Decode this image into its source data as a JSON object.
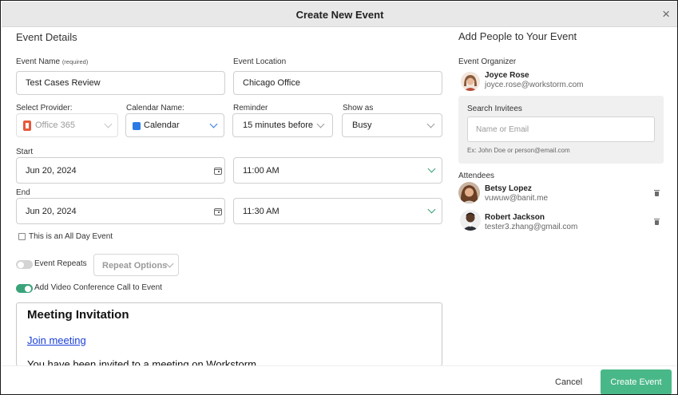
{
  "dialog": {
    "title": "Create New Event",
    "close_glyph": "×"
  },
  "event_details": {
    "section_title": "Event Details",
    "event_name": {
      "label": "Event Name",
      "label_note": "(required)",
      "value": "Test Cases Review"
    },
    "event_location": {
      "label": "Event Location",
      "value": "Chicago Office"
    },
    "provider": {
      "label": "Select Provider:",
      "value": "Office 365",
      "icon": "office-icon"
    },
    "calendar": {
      "label": "Calendar Name:",
      "value": "Calendar",
      "color": "#2c7be5"
    },
    "reminder": {
      "label": "Reminder",
      "value": "15 minutes before"
    },
    "show_as": {
      "label": "Show as",
      "value": "Busy"
    },
    "start": {
      "label": "Start",
      "date": "Jun 20, 2024",
      "time": "11:00 AM"
    },
    "end": {
      "label": "End",
      "date": "Jun 20, 2024",
      "time": "11:30 AM"
    },
    "all_day_label": "This is an All Day Event",
    "event_repeats_label": "Event Repeats",
    "repeat_options_label": "Repeat Options",
    "video_conf_label": "Add Video Conference Call to Event",
    "invitation": {
      "heading": "Meeting Invitation",
      "link_text": "Join meeting",
      "text": "You have been invited to a meeting on Workstorm"
    }
  },
  "people": {
    "section_title": "Add People to Your Event",
    "organizer_label": "Event Organizer",
    "organizer": {
      "name": "Joyce Rose",
      "email": "joyce.rose@workstorm.com"
    },
    "search": {
      "title": "Search Invitees",
      "placeholder": "Name or Email",
      "hint": "Ex: John Doe or person@email.com"
    },
    "attendees_label": "Attendees",
    "attendees": [
      {
        "name": "Betsy Lopez",
        "email": "vuwuw@banit.me"
      },
      {
        "name": "Robert Jackson",
        "email": "tester3.zhang@gmail.com"
      }
    ]
  },
  "footer": {
    "cancel_label": "Cancel",
    "create_label": "Create Event"
  },
  "colors": {
    "accent_green": "#49b889",
    "toggle_on": "#3aa37a",
    "link_blue": "#1a3fd8"
  }
}
